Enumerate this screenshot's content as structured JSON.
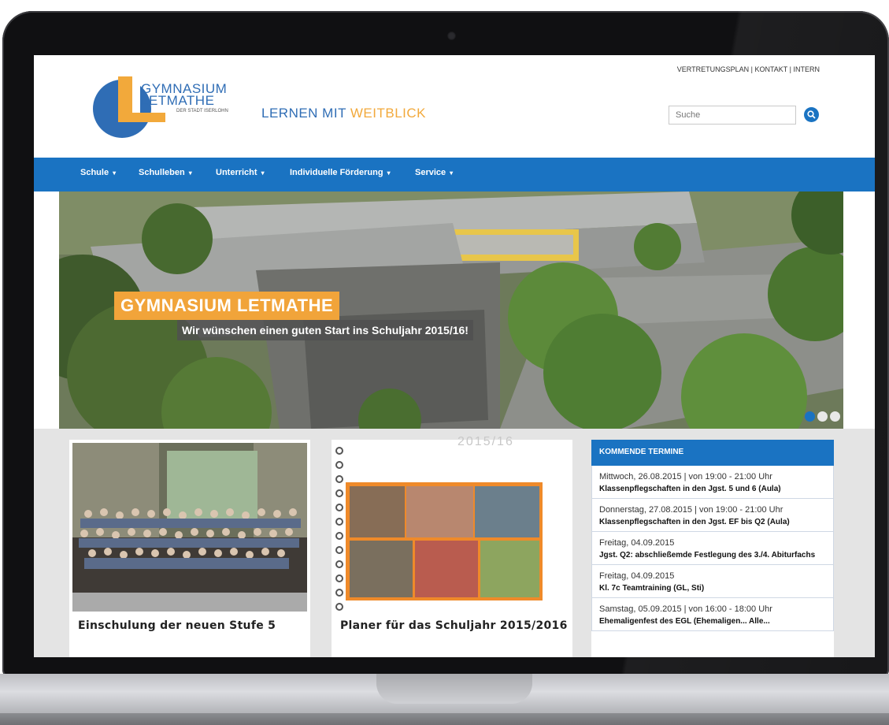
{
  "header": {
    "logo_line1": "GYMNASIUM",
    "logo_line2": "LETMATHE",
    "logo_sub": "DER STADT ISERLOHN",
    "slogan_part1": "LERNEN MIT ",
    "slogan_part2": "WEITBLICK",
    "top_links": [
      "VERTRETUNGSPLAN",
      "KONTAKT",
      "INTERN"
    ],
    "link_separator": " | ",
    "search_placeholder": "Suche"
  },
  "nav": {
    "items": [
      "Schule",
      "Schulleben",
      "Unterricht",
      "Individuelle Förderung",
      "Service"
    ],
    "caret": "▾"
  },
  "hero": {
    "title": "GYMNASIUM LETMATHE",
    "subtitle": "Wir wünschen einen guten Start ins Schuljahr 2015/16!",
    "slides": 3,
    "active_slide": 1
  },
  "cards": [
    {
      "title": "Einschulung der neuen Stufe 5"
    },
    {
      "title": "Planer für das Schuljahr 2015/2016",
      "planner_year": "2015/16"
    }
  ],
  "termine": {
    "heading": "KOMMENDE TERMINE",
    "entries": [
      {
        "date": "Mittwoch, 26.08.2015 | von 19:00 - 21:00 Uhr",
        "title": "Klassenpflegschaften in den Jgst. 5 und 6 (Aula)"
      },
      {
        "date": "Donnerstag, 27.08.2015 | von 19:00 - 21:00 Uhr",
        "title": "Klassenpflegschaften in den Jgst. EF bis Q2 (Aula)"
      },
      {
        "date": "Freitag, 04.09.2015",
        "title": "Jgst. Q2: abschließemde Festlegung des 3./4. Abiturfachs"
      },
      {
        "date": "Freitag, 04.09.2015",
        "title": "Kl. 7c Teamtraining (GL, Sti)"
      },
      {
        "date": "Samstag, 05.09.2015 | von 16:00 - 18:00 Uhr",
        "title": "Ehemaligenfest des EGL (Ehemaligen... Alle..."
      }
    ]
  },
  "colors": {
    "brand_blue": "#1a73c2",
    "brand_orange": "#f2a93b"
  }
}
